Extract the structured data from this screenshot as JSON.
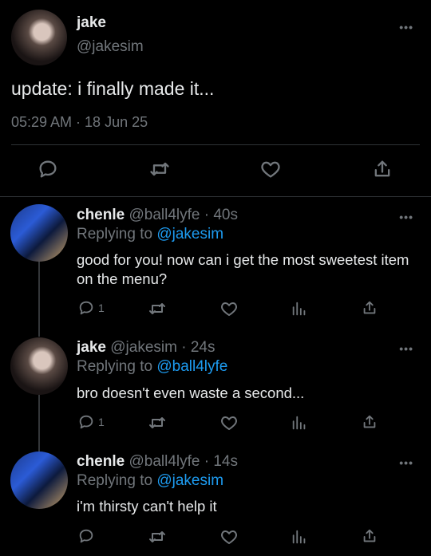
{
  "main_tweet": {
    "name": "jake",
    "handle": "@jakesim",
    "text": "update: i finally made it...",
    "timestamp": "05:29 AM · 18 Jun 25",
    "more": "•••"
  },
  "replies": [
    {
      "name": "chenle",
      "handle_time": "@ball4lyfe · 40s",
      "replying_prefix": "Replying to",
      "replying_to": "@jakesim",
      "text": "good for you! now can i get the most sweetest item on the menu?",
      "reply_count": "1",
      "more": "•••"
    },
    {
      "name": "jake",
      "handle_time": "@jakesim · 24s",
      "replying_prefix": "Replying to",
      "replying_to": "@ball4lyfe",
      "text": "bro doesn't even waste a second...",
      "reply_count": "1",
      "more": "•••"
    },
    {
      "name": "chenle",
      "handle_time": "@ball4lyfe · 14s",
      "replying_prefix": "Replying to",
      "replying_to": "@jakesim",
      "text": "i'm thirsty can't help it",
      "reply_count": "",
      "more": "•••"
    }
  ],
  "colors": {
    "background": "#000000",
    "link": "#1d9bf0",
    "muted": "#71767b",
    "text": "#e7e9ea"
  },
  "icons": [
    "reply-icon",
    "retweet-icon",
    "like-icon",
    "share-icon",
    "analytics-icon",
    "more-icon"
  ]
}
